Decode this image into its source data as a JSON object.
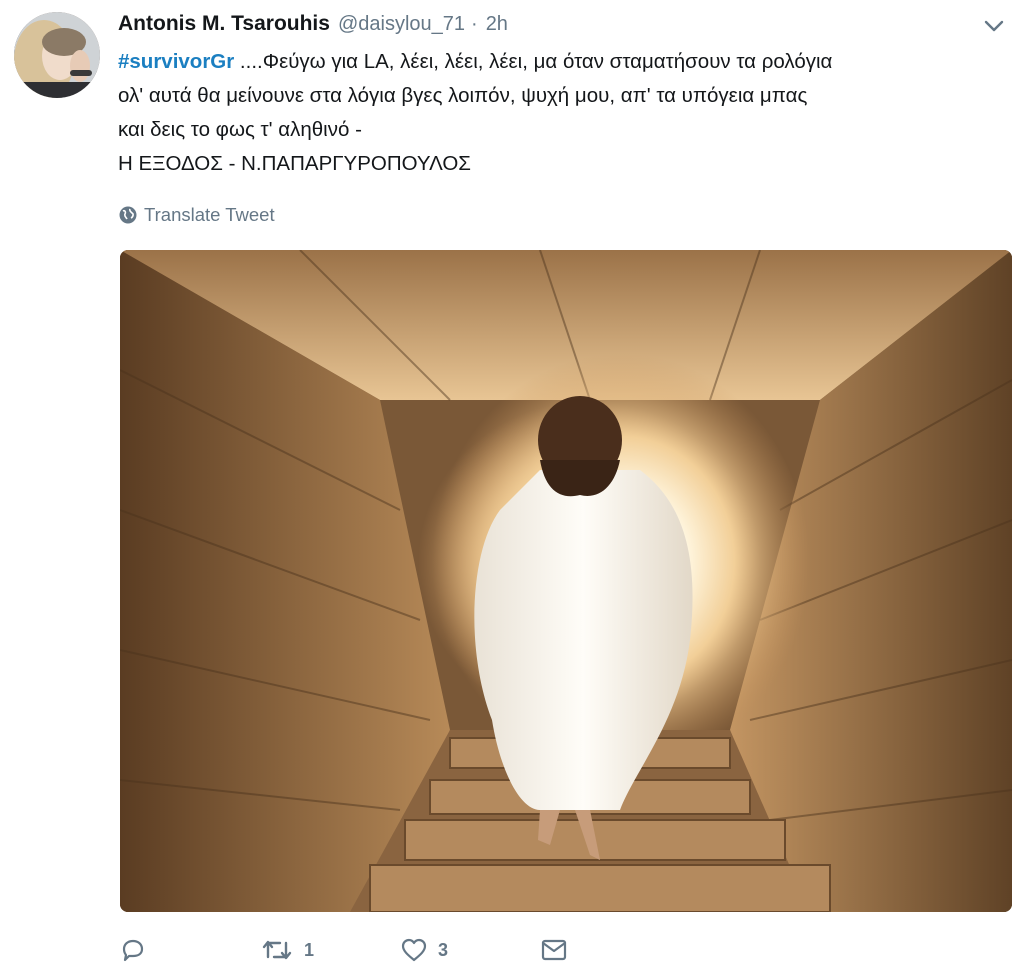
{
  "tweet": {
    "author_name": "Antonis M. Tsarouhis",
    "handle": "@daisylou_71",
    "separator": "·",
    "time": "2h",
    "hashtag": "#survivorGr",
    "text_lines": [
      " ....Φεύγω για LA,  λέει, λέει, λέει, μα όταν σταματήσουν τα ρολόγια",
      "ολ' αυτά θα μείνουνε στα λόγια βγες λοιπόν, ψυχή μου, απ' τα υπόγεια μπας",
      "και δεις το φως τ' αληθινό -",
      "Η ΕΞΟΔΟΣ - Ν.ΠΑΠΑΡΓΥΡΟΠΟΥΛΟΣ"
    ],
    "translate_label": "Translate Tweet",
    "retweet_count": "1",
    "like_count": "3"
  },
  "icons": {
    "menu": "chevron-down-icon",
    "translate": "globe-icon",
    "reply": "reply-icon",
    "retweet": "retweet-icon",
    "like": "heart-icon",
    "message": "envelope-icon"
  },
  "colors": {
    "hashtag": "#1b7fc1",
    "secondary_text": "#657786",
    "primary_text": "#14171a"
  }
}
